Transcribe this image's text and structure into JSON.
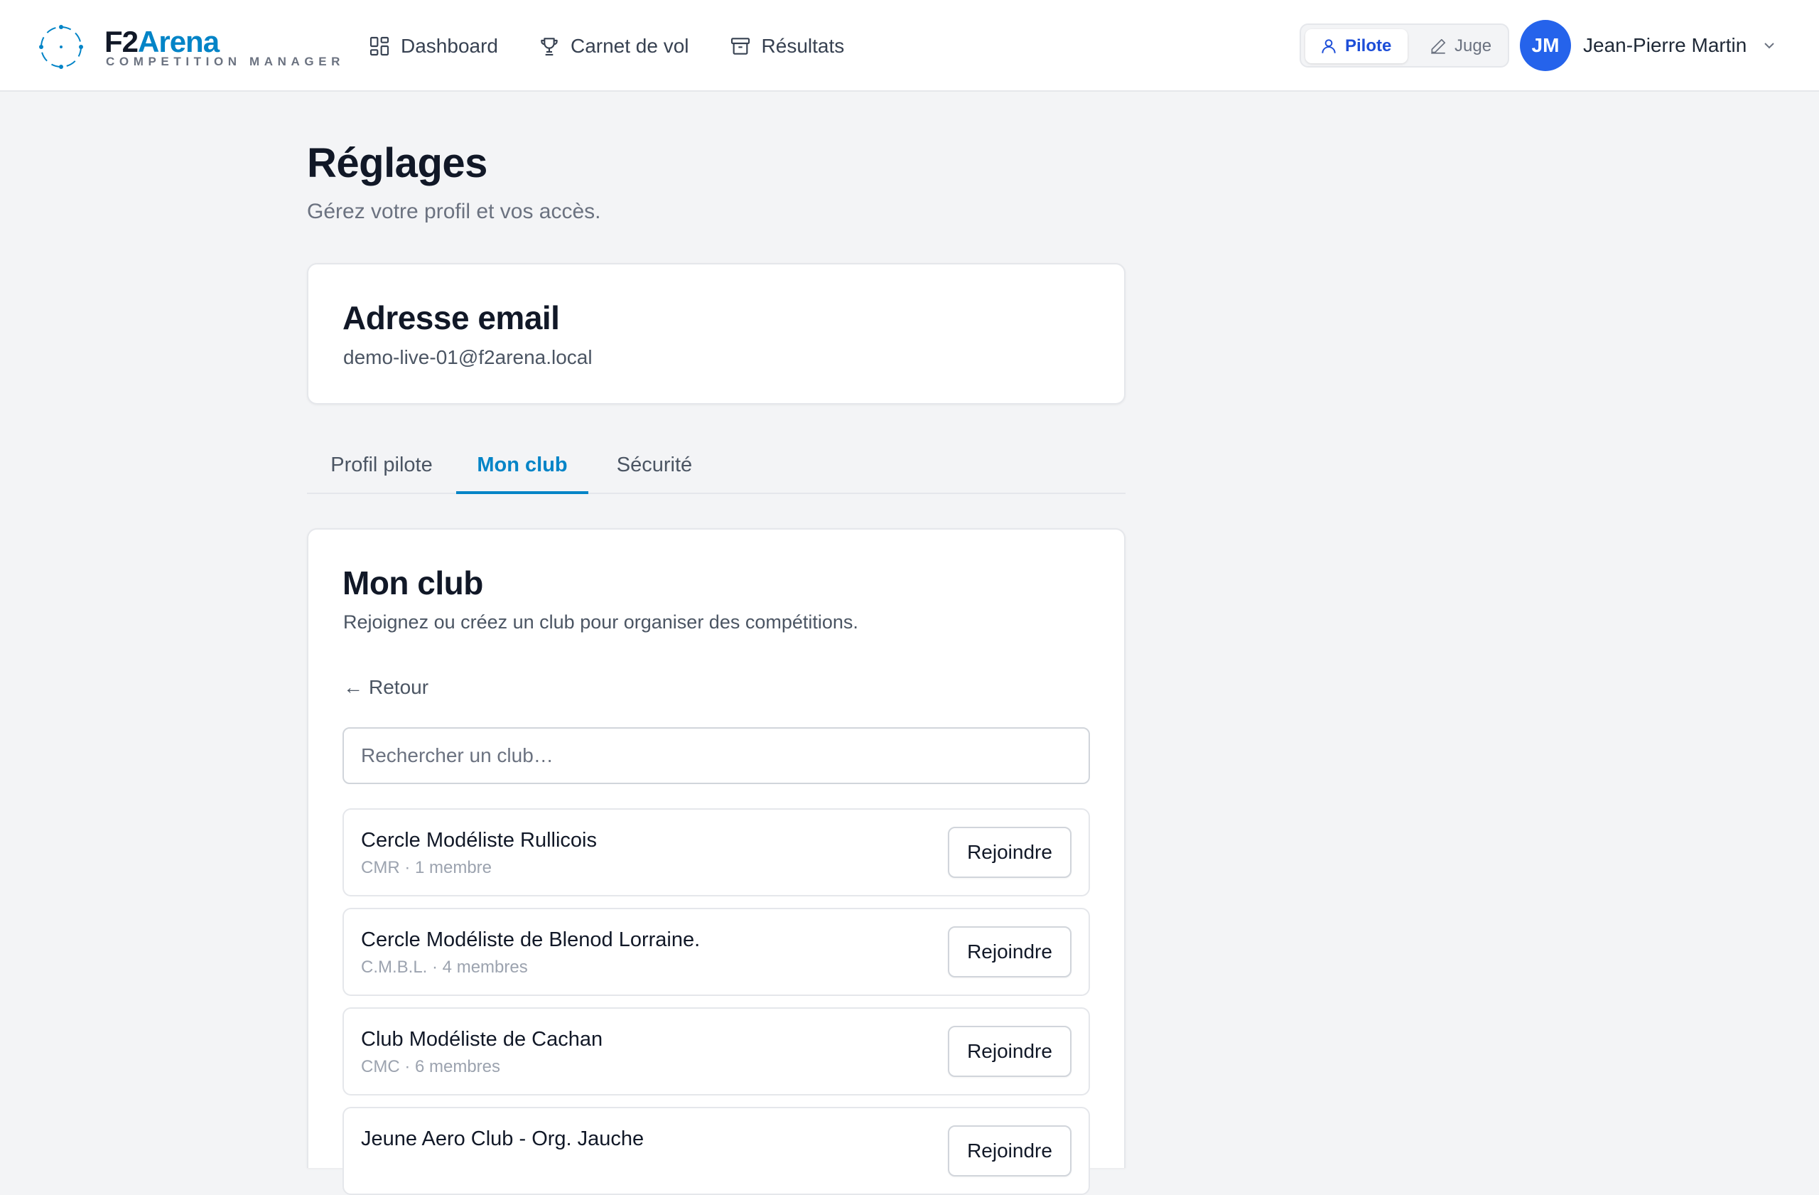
{
  "header": {
    "logo_main": "F2",
    "logo_accent": "Arena",
    "logo_tagline": "COMPETITION MANAGER",
    "nav": [
      {
        "label": "Dashboard",
        "icon": "dashboard-icon"
      },
      {
        "label": "Carnet de vol",
        "icon": "trophy-icon"
      },
      {
        "label": "Résultats",
        "icon": "archive-icon"
      }
    ],
    "roles": [
      {
        "label": "Pilote",
        "icon": "user-icon",
        "active": true
      },
      {
        "label": "Juge",
        "icon": "pencil-icon",
        "active": false
      }
    ],
    "user": {
      "initials": "JM",
      "name": "Jean-Pierre Martin"
    }
  },
  "page": {
    "title": "Réglages",
    "subtitle": "Gérez votre profil et vos accès."
  },
  "email_card": {
    "title": "Adresse email",
    "value": "demo-live-01@f2arena.local"
  },
  "tabs": [
    {
      "label": "Profil pilote",
      "active": false
    },
    {
      "label": "Mon club",
      "active": true
    },
    {
      "label": "Sécurité",
      "active": false
    }
  ],
  "club_card": {
    "title": "Mon club",
    "description": "Rejoignez ou créez un club pour organiser des compétitions.",
    "back_label": "Retour",
    "search_placeholder": "Rechercher un club…",
    "join_label": "Rejoindre",
    "clubs": [
      {
        "name": "Cercle Modéliste Rullicois",
        "meta": "CMR · 1 membre"
      },
      {
        "name": "Cercle Modéliste de Blenod Lorraine.",
        "meta": "C.M.B.L. · 4 membres"
      },
      {
        "name": "Club Modéliste de Cachan",
        "meta": "CMC · 6 membres"
      },
      {
        "name": "Jeune Aero Club - Org. Jauche",
        "meta": ""
      }
    ]
  },
  "colors": {
    "accent": "#0284c7",
    "avatar": "#2563eb",
    "role_active": "#1d4ed8",
    "background": "#f3f4f6"
  }
}
